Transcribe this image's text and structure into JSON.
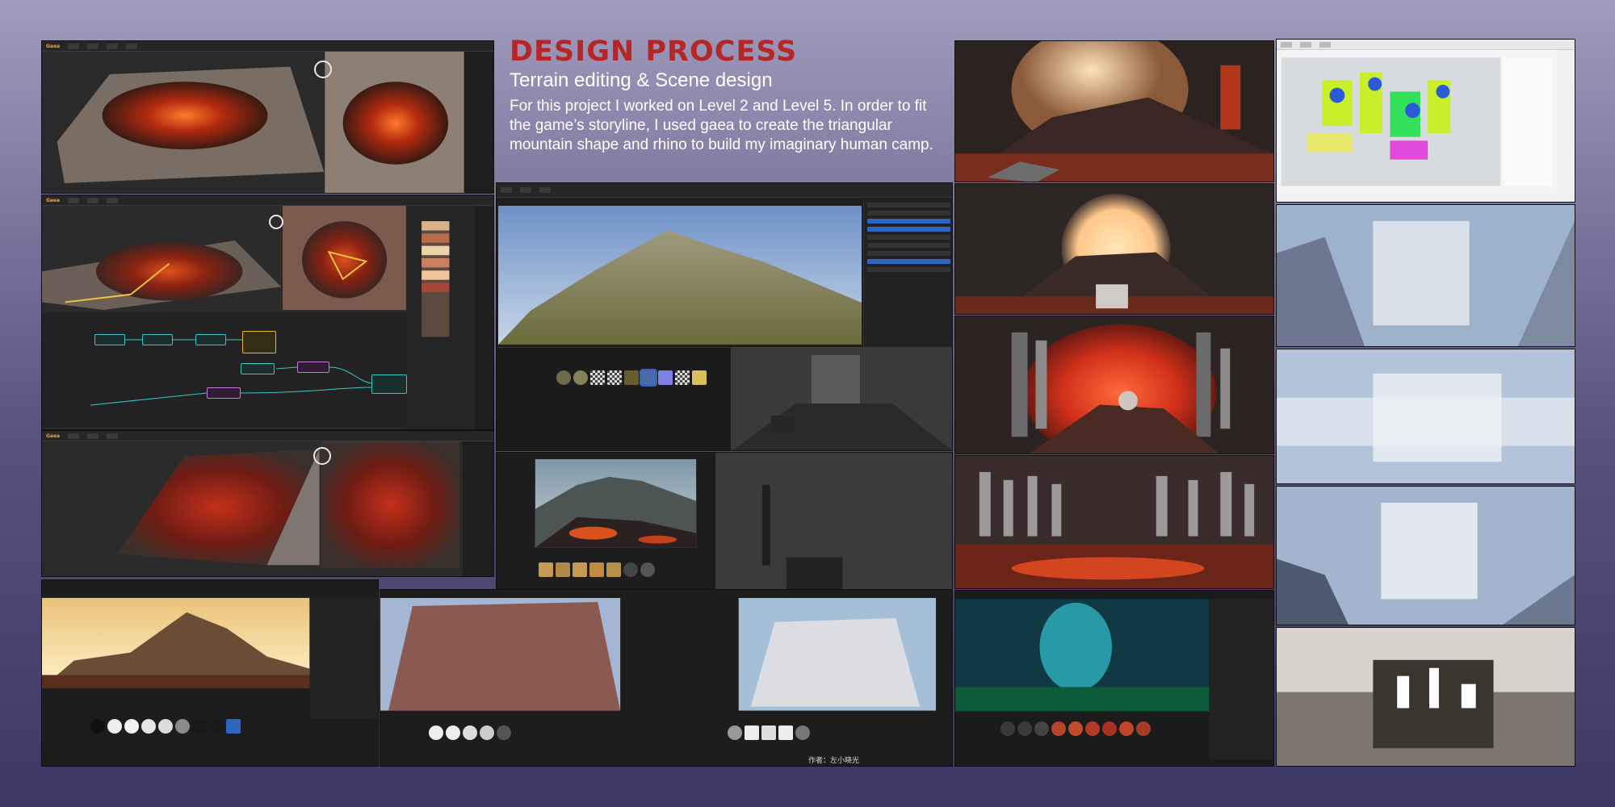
{
  "heading": {
    "title": "DESIGN PROCESS",
    "subtitle": "Terrain editing & Scene design",
    "body": "For this project I worked on Level 2 and Level 5. In order to fit the game’s storyline, I used gaea to create the triangular mountain shape and rhino to build my imaginary human camp."
  },
  "gaea": {
    "app_name": "Gaea"
  },
  "colors": {
    "title_red": "#b62626",
    "background_top": "#a19cbd",
    "background_bottom": "#3e3766",
    "lava": "#d2401a",
    "selection_blue": "#2d66c0"
  },
  "footer": {
    "credit": "作者：左小晓光"
  }
}
